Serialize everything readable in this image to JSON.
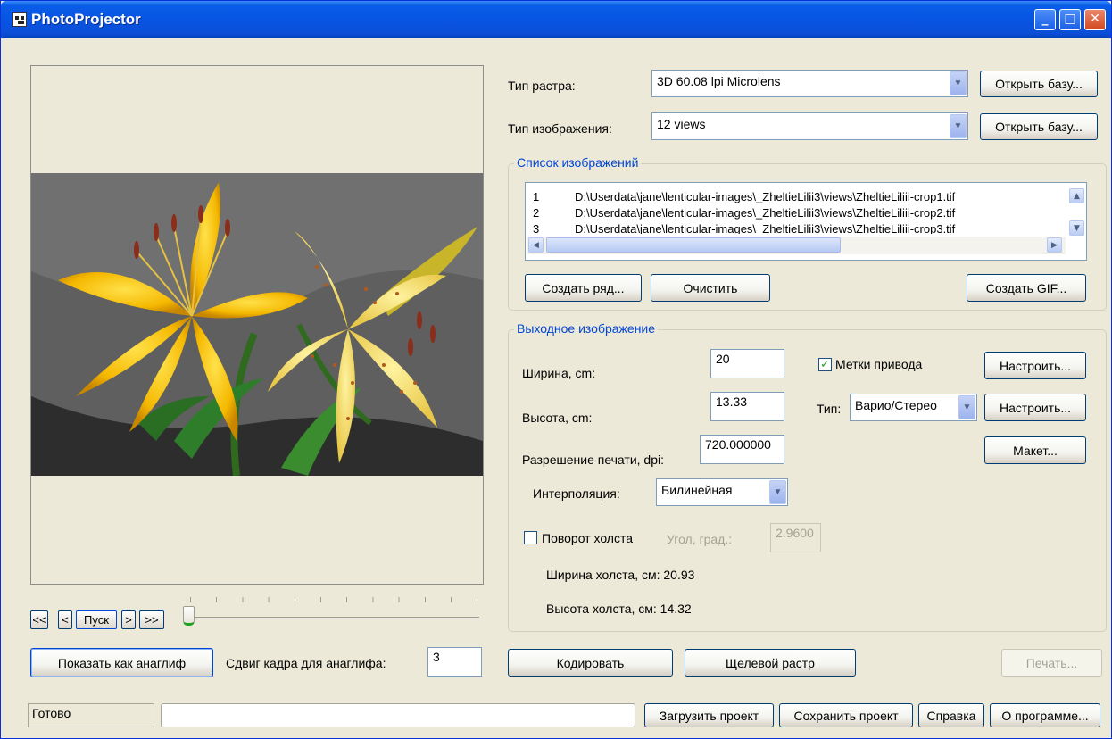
{
  "window": {
    "title": "PhotoProjector"
  },
  "raster": {
    "label": "Тип растра:",
    "value": "3D 60.08 lpi Microlens",
    "open_db": "Открыть базу..."
  },
  "image_type": {
    "label": "Тип изображения:",
    "value": "12 views",
    "open_db": "Открыть базу..."
  },
  "image_list": {
    "title": "Список изображений",
    "rows": [
      {
        "num": "1",
        "path": "D:\\Userdata\\jane\\lenticular-images\\_ZheltieLilii3\\views\\ZheltieLiliii-crop1.tif"
      },
      {
        "num": "2",
        "path": "D:\\Userdata\\jane\\lenticular-images\\_ZheltieLilii3\\views\\ZheltieLiliii-crop2.tif"
      },
      {
        "num": "3",
        "path": "D:\\Userdata\\jane\\lenticular-images\\_ZheltieLilii3\\views\\ZheltieLiliii-crop3.tif"
      }
    ],
    "create_row": "Создать ряд...",
    "clear": "Очистить",
    "create_gif": "Создать GIF..."
  },
  "output": {
    "title": "Выходное изображение",
    "width_label": "Ширина, cm:",
    "width_value": "20",
    "height_label": "Высота,  cm:",
    "height_value": "13.33",
    "dpi_label": "Разрешение печати, dpi:",
    "dpi_value": "720.000000",
    "interp_label": "Интерполяция:",
    "interp_value": "Билинейная",
    "marks_label": "Метки привода",
    "marks_checked": true,
    "configure1": "Настроить...",
    "type_label": "Тип:",
    "type_value": "Варио/Стерео",
    "configure2": "Настроить...",
    "layout": "Макет...",
    "rotate_label": "Поворот холста",
    "rotate_checked": false,
    "angle_label": "Угол, град.:",
    "angle_value": "2.9600",
    "canvas_width": "Ширина холста, см:  20.93",
    "canvas_height": "Высота холста,  см:  14.32"
  },
  "playback": {
    "first": "<<",
    "prev": "<",
    "play": "Пуск",
    "next": ">",
    "last": ">>"
  },
  "anaglyph": {
    "show": "Показать как анаглиф",
    "shift_label": "Сдвиг кадра для анаглифа:",
    "shift_value": "3"
  },
  "actions": {
    "encode": "Кодировать",
    "slit_raster": "Щелевой растр",
    "print": "Печать..."
  },
  "statusbar": {
    "status": "Готово",
    "load_project": "Загрузить проект",
    "save_project": "Сохранить проект",
    "help": "Справка",
    "about": "О программе..."
  },
  "colors": {
    "titlebar": "#0a5ee8",
    "window_bg": "#ece9d8",
    "group_title": "#0046d5",
    "lily_yellow": "#f5b800"
  }
}
